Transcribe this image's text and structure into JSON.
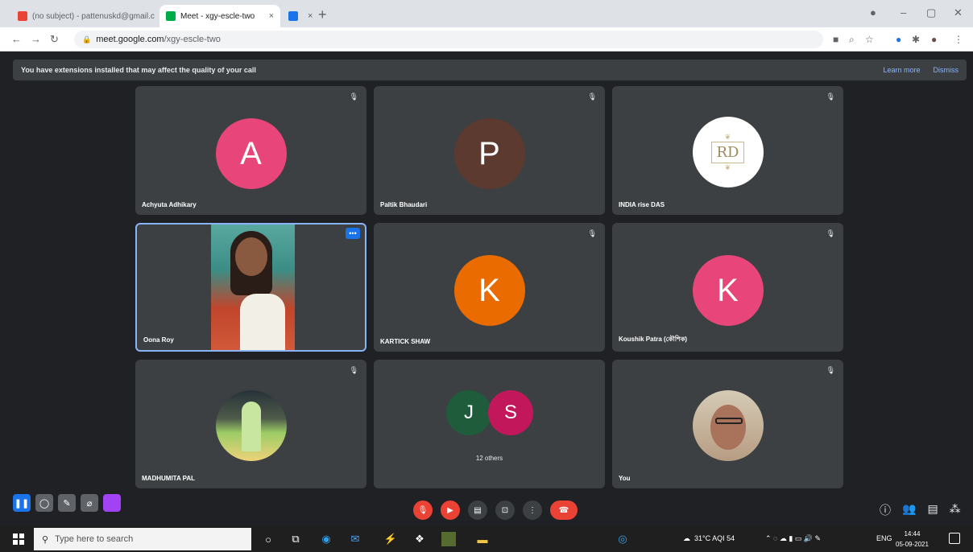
{
  "browser": {
    "tabs": [
      {
        "title": "(no subject) - pattenuskd@gmail.c",
        "active": false
      },
      {
        "title": "Meet - xgy-escle-two",
        "active": true
      },
      {
        "title": "",
        "active": false
      }
    ],
    "url_host": "meet.google.com",
    "url_path": "/xgy-escle-two"
  },
  "banner": {
    "message": "You have extensions installed that may affect the quality of your call",
    "learn_more": "Learn more",
    "dismiss": "Dismiss"
  },
  "participants": [
    {
      "name": "Achyuta Adhikary",
      "initial": "A",
      "color": "#e8457a"
    },
    {
      "name": "Paltik Bhaudari",
      "initial": "P",
      "color": "#5d3a2f"
    },
    {
      "name": "INDIA rise DAS",
      "initial": "",
      "logo": "RD"
    },
    {
      "name": "Oona Roy",
      "video": true
    },
    {
      "name": "KARTICK SHAW",
      "initial": "K",
      "color": "#ea6c00"
    },
    {
      "name": "Koushik Patra (কৌশিক)",
      "initial": "K",
      "color": "#e8457a"
    },
    {
      "name": "MADHUMITA PAL",
      "photo": true
    },
    {
      "name": "",
      "group": [
        "J",
        "S"
      ],
      "group_colors": [
        "#1e5c3c",
        "#c2185b"
      ],
      "others": "12 others"
    },
    {
      "name": "You",
      "photo": true
    }
  ],
  "icons": {
    "mic_off": "mic-off-icon",
    "more": "more-icon"
  },
  "taskbar": {
    "search_placeholder": "Type here to search",
    "weather": "31°C  AQI 54",
    "lang": "ENG",
    "time": "14:44",
    "date": "05-09-2021"
  }
}
